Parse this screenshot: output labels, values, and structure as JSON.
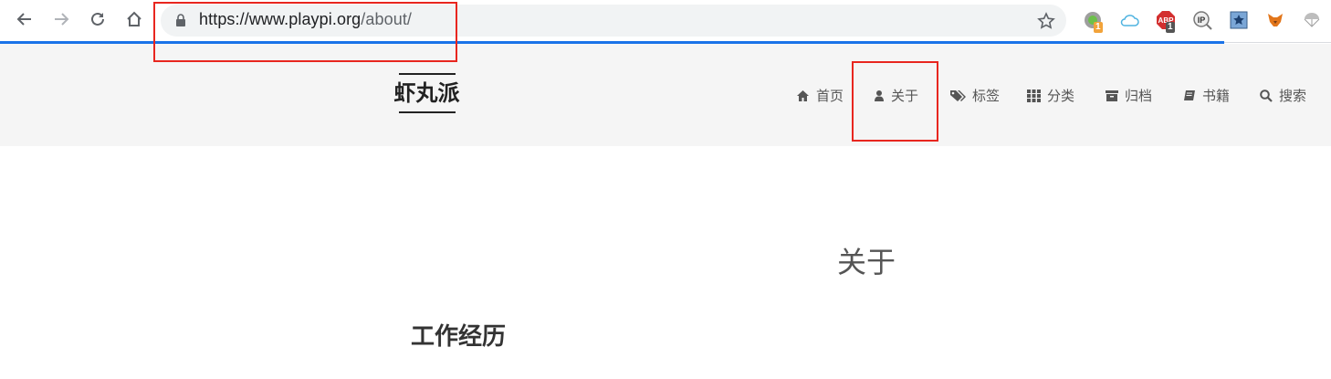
{
  "browser": {
    "url_host": "https://www.playpi.org",
    "url_path": "/about/",
    "extensions": [
      {
        "name": "chrome-ext-1",
        "badge": "1",
        "badge_color": "#f2a33a"
      },
      {
        "name": "cloud-ext"
      },
      {
        "name": "adblock-plus",
        "label": "ABP",
        "badge": "1",
        "badge_color": "#555555"
      },
      {
        "name": "ip-ext",
        "label": "IP"
      },
      {
        "name": "bookmark-ext"
      },
      {
        "name": "metamask-ext"
      },
      {
        "name": "parachute-ext"
      }
    ]
  },
  "site": {
    "brand": "虾丸派",
    "menu": [
      {
        "label": "首页",
        "icon": "home-icon"
      },
      {
        "label": "关于",
        "icon": "user-icon"
      },
      {
        "label": "标签",
        "icon": "tags-icon"
      },
      {
        "label": "分类",
        "icon": "th-icon"
      },
      {
        "label": "归档",
        "icon": "archive-icon"
      },
      {
        "label": "书籍",
        "icon": "book-icon"
      },
      {
        "label": "搜索",
        "icon": "search-icon"
      }
    ]
  },
  "content": {
    "title": "关于",
    "section_heading": "工作经历"
  },
  "colors": {
    "accent_progress": "#1a73e8",
    "highlight_box": "#e8261f",
    "header_bg": "#f5f5f5"
  }
}
